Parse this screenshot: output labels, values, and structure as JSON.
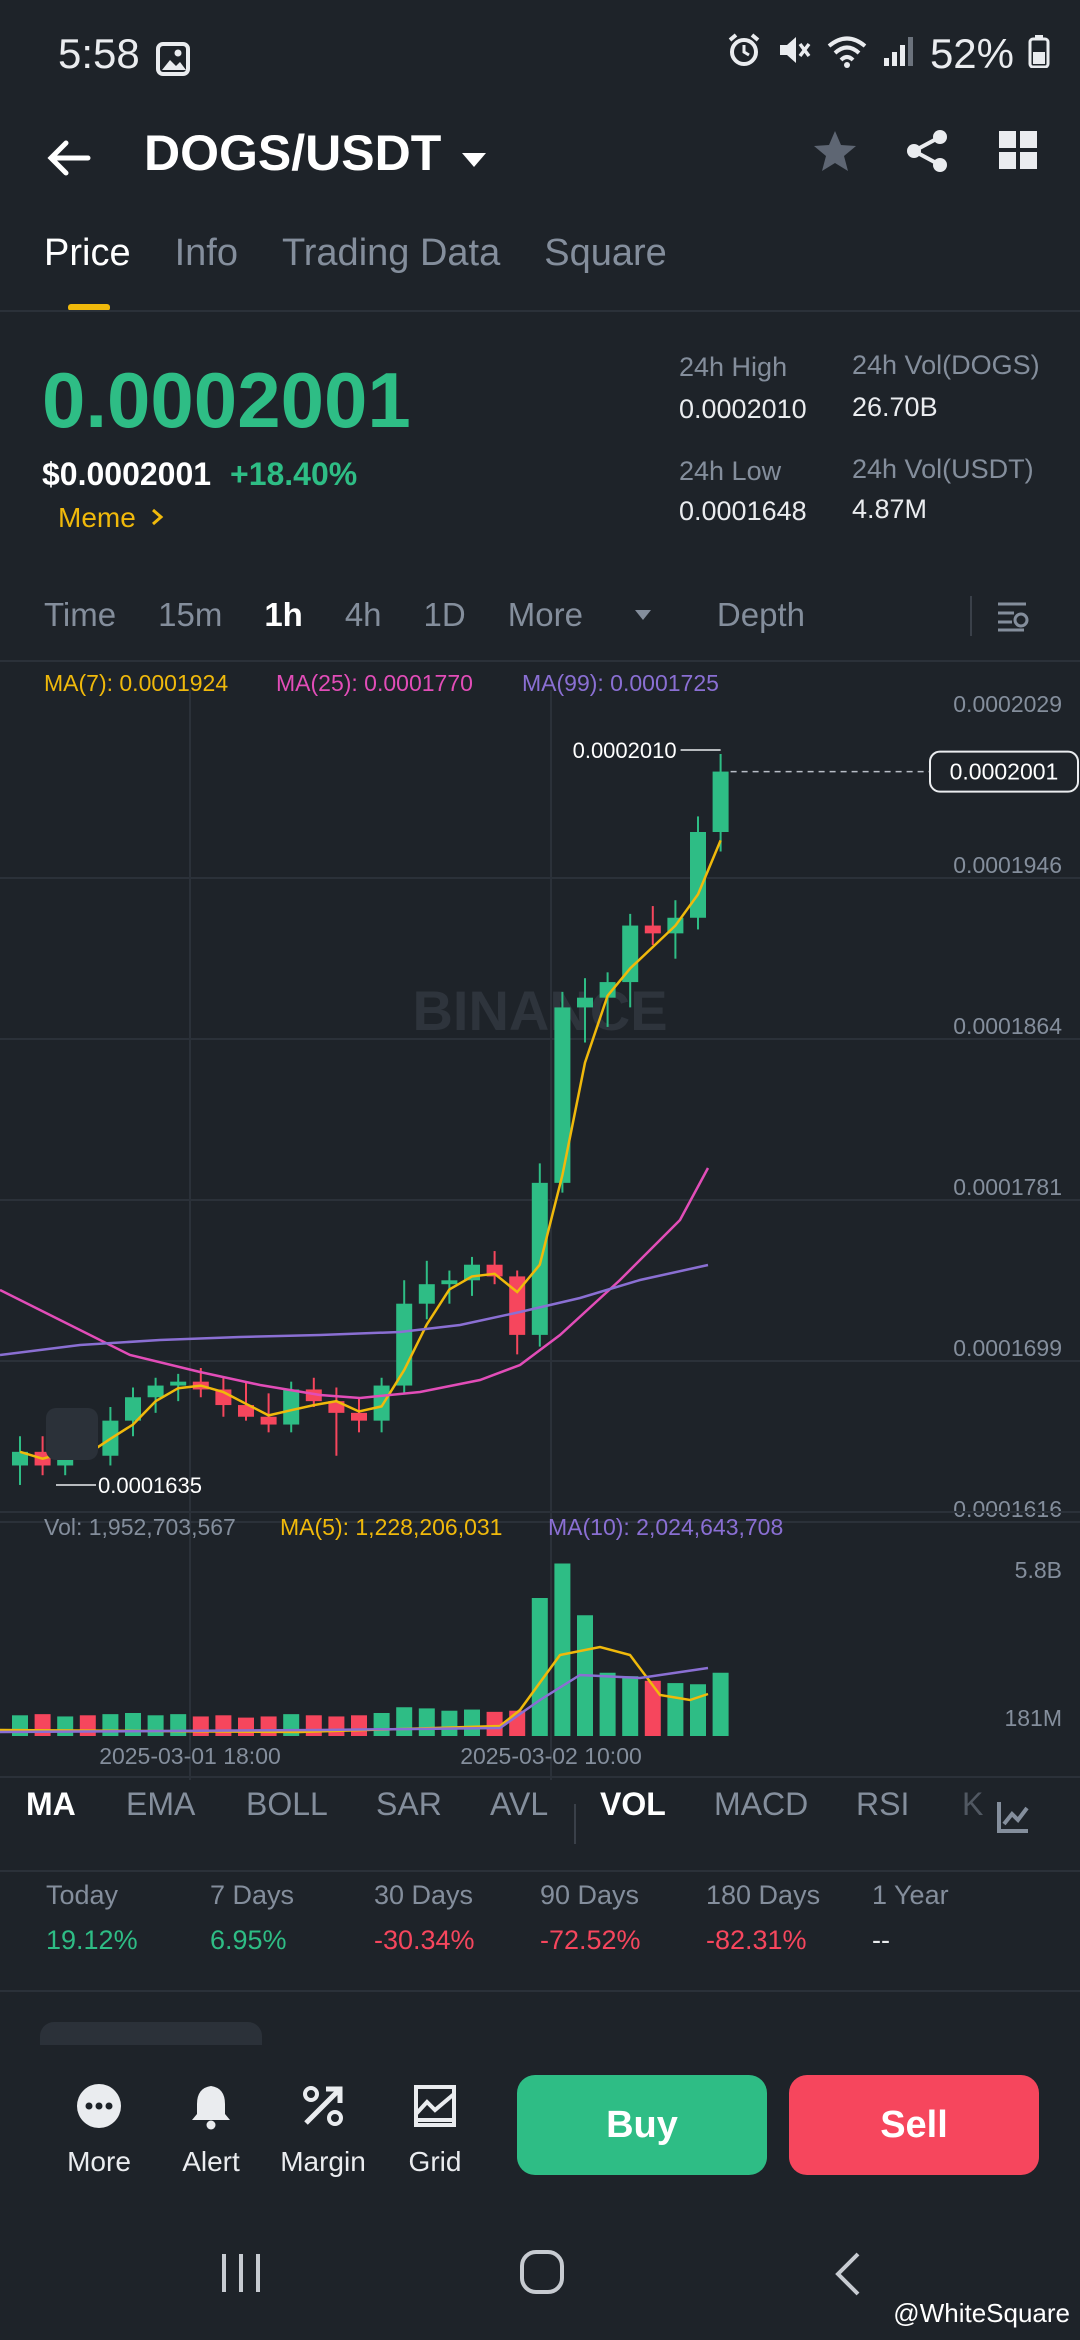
{
  "status": {
    "time": "5:58",
    "battery": "52%"
  },
  "header": {
    "pair": "DOGS/USDT"
  },
  "tabs": [
    "Price",
    "Info",
    "Trading Data",
    "Square"
  ],
  "ticker": {
    "last_price": "0.0002001",
    "usd_price": "$0.0002001",
    "change": "+18.40%",
    "tag": "Meme",
    "high_label": "24h High",
    "high": "0.0002010",
    "low_label": "24h Low",
    "low": "0.0001648",
    "vol_base_label": "24h Vol(DOGS)",
    "vol_base": "26.70B",
    "vol_quote_label": "24h Vol(USDT)",
    "vol_quote": "4.87M"
  },
  "timeframes": [
    "Time",
    "15m",
    "1h",
    "4h",
    "1D",
    "More",
    "Depth"
  ],
  "ma_legend": {
    "ma7": "MA(7): 0.0001924",
    "ma25": "MA(25): 0.0001770",
    "ma99": "MA(99): 0.0001725"
  },
  "vol_legend": {
    "vol": "Vol: 1,952,703,567",
    "ma5": "MA(5): 1,228,206,031",
    "ma10": "MA(10): 2,024,643,708"
  },
  "colors": {
    "up": "#2ebd85",
    "down": "#f6465d",
    "ma7": "#f0b90b",
    "ma25": "#e24db8",
    "ma99": "#8a6fd3",
    "accent": "#f0b90b"
  },
  "chart_data": {
    "type": "candlestick",
    "price_axis": [
      "0.0002029",
      "0.0001946",
      "0.0001864",
      "0.0001781",
      "0.0001699",
      "0.0001616"
    ],
    "price_range": [
      0.0001616,
      0.0002029
    ],
    "high_label": "0.0002010",
    "low_label": "0.0001635",
    "current_label": "0.0002001",
    "volume_axis": [
      "5.8B",
      "181M"
    ],
    "x_labels": [
      "2025-03-01 18:00",
      "2025-03-02 10:00"
    ],
    "candles": [
      {
        "o": 0.0001645,
        "h": 0.000166,
        "l": 0.0001635,
        "c": 0.0001652
      },
      {
        "o": 0.0001652,
        "h": 0.000166,
        "l": 0.000164,
        "c": 0.0001645
      },
      {
        "o": 0.0001645,
        "h": 0.0001665,
        "l": 0.000164,
        "c": 0.0001658
      },
      {
        "o": 0.0001658,
        "h": 0.000167,
        "l": 0.0001648,
        "c": 0.000165
      },
      {
        "o": 0.000165,
        "h": 0.0001675,
        "l": 0.0001645,
        "c": 0.0001668
      },
      {
        "o": 0.0001668,
        "h": 0.0001685,
        "l": 0.000166,
        "c": 0.000168
      },
      {
        "o": 0.000168,
        "h": 0.000169,
        "l": 0.0001672,
        "c": 0.0001686
      },
      {
        "o": 0.0001686,
        "h": 0.0001692,
        "l": 0.0001678,
        "c": 0.0001688
      },
      {
        "o": 0.0001688,
        "h": 0.0001695,
        "l": 0.000168,
        "c": 0.0001684
      },
      {
        "o": 0.0001684,
        "h": 0.000169,
        "l": 0.000167,
        "c": 0.0001676
      },
      {
        "o": 0.0001676,
        "h": 0.0001688,
        "l": 0.0001668,
        "c": 0.000167
      },
      {
        "o": 0.000167,
        "h": 0.0001682,
        "l": 0.0001662,
        "c": 0.0001666
      },
      {
        "o": 0.0001666,
        "h": 0.0001688,
        "l": 0.0001662,
        "c": 0.0001684
      },
      {
        "o": 0.0001684,
        "h": 0.000169,
        "l": 0.0001675,
        "c": 0.0001678
      },
      {
        "o": 0.0001678,
        "h": 0.0001685,
        "l": 0.000165,
        "c": 0.0001672
      },
      {
        "o": 0.0001672,
        "h": 0.000168,
        "l": 0.0001662,
        "c": 0.0001668
      },
      {
        "o": 0.0001668,
        "h": 0.000169,
        "l": 0.0001662,
        "c": 0.0001686
      },
      {
        "o": 0.0001686,
        "h": 0.000174,
        "l": 0.0001682,
        "c": 0.0001728
      },
      {
        "o": 0.0001728,
        "h": 0.000175,
        "l": 0.000172,
        "c": 0.0001738
      },
      {
        "o": 0.0001738,
        "h": 0.0001745,
        "l": 0.0001728,
        "c": 0.000174
      },
      {
        "o": 0.000174,
        "h": 0.0001752,
        "l": 0.0001732,
        "c": 0.0001748
      },
      {
        "o": 0.0001748,
        "h": 0.0001755,
        "l": 0.0001738,
        "c": 0.0001742
      },
      {
        "o": 0.0001742,
        "h": 0.0001745,
        "l": 0.0001702,
        "c": 0.0001712
      },
      {
        "o": 0.0001712,
        "h": 0.00018,
        "l": 0.0001706,
        "c": 0.000179
      },
      {
        "o": 0.000179,
        "h": 0.0001888,
        "l": 0.0001785,
        "c": 0.000188
      },
      {
        "o": 0.000188,
        "h": 0.0001895,
        "l": 0.0001862,
        "c": 0.0001885
      },
      {
        "o": 0.0001885,
        "h": 0.0001898,
        "l": 0.000187,
        "c": 0.0001893
      },
      {
        "o": 0.0001893,
        "h": 0.0001928,
        "l": 0.000188,
        "c": 0.0001922
      },
      {
        "o": 0.0001922,
        "h": 0.0001932,
        "l": 0.0001912,
        "c": 0.0001918
      },
      {
        "o": 0.0001918,
        "h": 0.0001935,
        "l": 0.0001905,
        "c": 0.0001926
      },
      {
        "o": 0.0001926,
        "h": 0.0001978,
        "l": 0.000192,
        "c": 0.000197
      },
      {
        "o": 0.000197,
        "h": 0.000201,
        "l": 0.000196,
        "c": 0.0002001
      }
    ],
    "volumes": [
      0.18,
      0.19,
      0.17,
      0.18,
      0.19,
      0.2,
      0.18,
      0.19,
      0.17,
      0.18,
      0.16,
      0.17,
      0.19,
      0.18,
      0.17,
      0.18,
      0.2,
      0.25,
      0.24,
      0.22,
      0.23,
      0.21,
      0.22,
      1.2,
      1.5,
      1.05,
      0.55,
      0.52,
      0.48,
      0.46,
      0.45,
      0.55
    ]
  },
  "indicators": [
    "MA",
    "EMA",
    "BOLL",
    "SAR",
    "AVL",
    "VOL",
    "MACD",
    "RSI",
    "K"
  ],
  "performance": [
    {
      "label": "Today",
      "value": "19.12%",
      "dir": "up"
    },
    {
      "label": "7 Days",
      "value": "6.95%",
      "dir": "up"
    },
    {
      "label": "30 Days",
      "value": "-30.34%",
      "dir": "down"
    },
    {
      "label": "90 Days",
      "value": "-72.52%",
      "dir": "down"
    },
    {
      "label": "180 Days",
      "value": "-82.31%",
      "dir": "down"
    },
    {
      "label": "1 Year",
      "value": "--",
      "dir": "flat"
    }
  ],
  "bottom_actions": [
    "More",
    "Alert",
    "Margin",
    "Grid"
  ],
  "buttons": {
    "buy": "Buy",
    "sell": "Sell"
  },
  "watermark": "@WhiteSquare",
  "chart_watermark": "BINANCE"
}
